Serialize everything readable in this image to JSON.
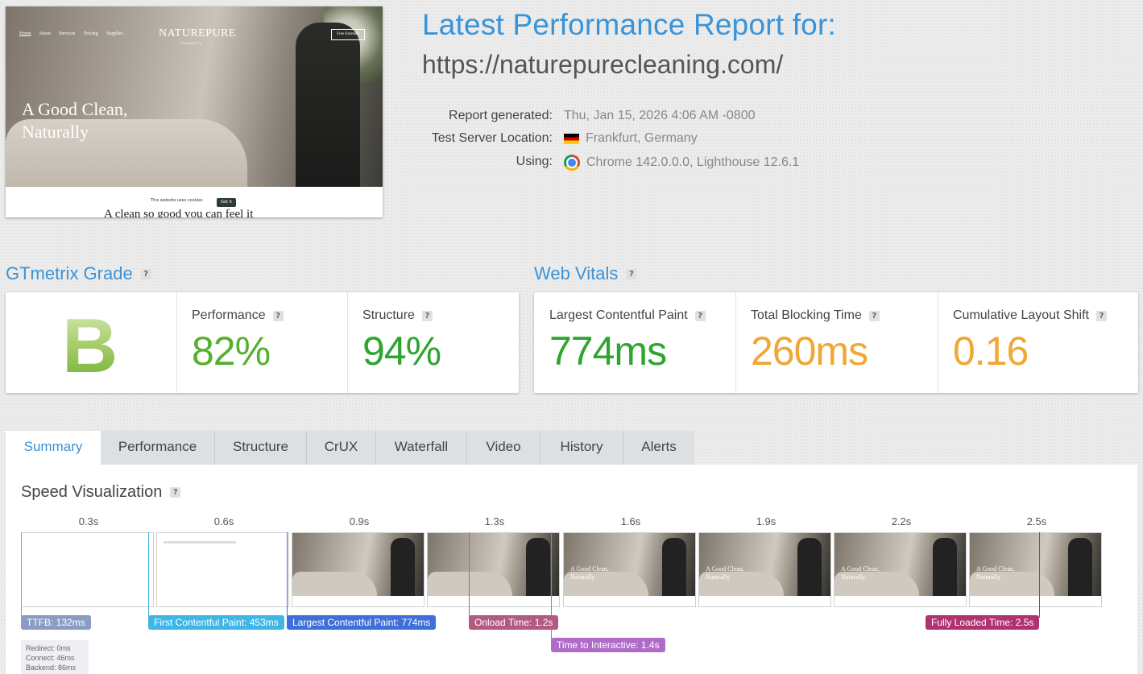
{
  "thumbnail": {
    "nav_items": [
      "Home",
      "About",
      "Services",
      "Pricing",
      "Supplies"
    ],
    "brand": "NATUREPURE",
    "brand_sub": "Cleaning Co.",
    "nav_button": "Free Estimate",
    "headline_line1": "A Good Clean,",
    "headline_line2": "Naturally",
    "cookie_text": "This website uses cookies",
    "cookie_button": "Got it",
    "tagline": "A clean so good you can feel it"
  },
  "report": {
    "title": "Latest Performance Report for:",
    "url": "https://naturepurecleaning.com/",
    "generated_label": "Report generated:",
    "generated_value": "Thu, Jan 15, 2026 4:06 AM -0800",
    "location_label": "Test Server Location:",
    "location_value": "Frankfurt, Germany",
    "using_label": "Using:",
    "using_value": "Chrome 142.0.0.0, Lighthouse 12.6.1"
  },
  "grade": {
    "title": "GTmetrix Grade",
    "letter": "B",
    "performance_label": "Performance",
    "performance_value": "82%",
    "structure_label": "Structure",
    "structure_value": "94%"
  },
  "vitals": {
    "title": "Web Vitals",
    "lcp_label": "Largest Contentful Paint",
    "lcp_value": "774ms",
    "tbt_label": "Total Blocking Time",
    "tbt_value": "260ms",
    "cls_label": "Cumulative Layout Shift",
    "cls_value": "0.16"
  },
  "colors": {
    "accent": "#3a93d6",
    "good": "#55b02e",
    "good_dark": "#2ea52e",
    "warn": "#f0a733",
    "ttfb": "#8b9cc2",
    "fcp": "#3fb6e6",
    "lcp": "#3f6fd8",
    "onload": "#b25a80",
    "tti": "#b06bc9",
    "fully_loaded": "#b0336f"
  },
  "tabs": [
    "Summary",
    "Performance",
    "Structure",
    "CrUX",
    "Waterfall",
    "Video",
    "History",
    "Alerts"
  ],
  "speed_viz": {
    "title": "Speed Visualization",
    "times": [
      "0.3s",
      "0.6s",
      "0.9s",
      "1.3s",
      "1.6s",
      "1.9s",
      "2.2s",
      "2.5s"
    ],
    "frame_text": [
      "A Good Clean,",
      "Naturally"
    ],
    "badges": {
      "ttfb": "TTFB: 132ms",
      "fcp": "First Contentful Paint: 453ms",
      "lcp": "Largest Contentful Paint: 774ms",
      "onload": "Onload Time: 1.2s",
      "tti": "Time to Interactive: 1.4s",
      "fully_loaded": "Fully Loaded Time: 2.5s"
    },
    "ttfb_detail": {
      "redirect": "Redirect: 0ms",
      "connect": "Connect: 46ms",
      "backend": "Backend: 86ms"
    }
  }
}
